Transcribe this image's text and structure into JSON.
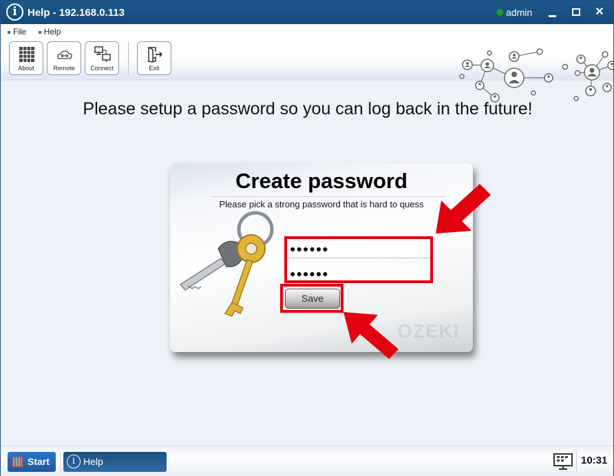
{
  "window": {
    "title": "Help - 192.168.0.113",
    "user": "admin",
    "status_color": "#1e9a2d",
    "controls": {
      "minimize": "minimize-icon",
      "maximize": "maximize-icon",
      "close": "close-icon"
    }
  },
  "menu": {
    "items": [
      "File",
      "Help"
    ]
  },
  "toolbar": {
    "buttons": [
      {
        "label": "About",
        "icon": "grid-icon"
      },
      {
        "label": "Remote",
        "icon": "cloud-arrows-icon"
      },
      {
        "label": "Connect",
        "icon": "network-computers-icon"
      },
      {
        "label": "Exit",
        "icon": "exit-door-icon"
      }
    ]
  },
  "main": {
    "headline": "Please setup a password so you can log back in the future!"
  },
  "dialog": {
    "title": "Create password",
    "subtitle": "Please pick a strong password that is hard to quess",
    "password_value": "●●●●●●",
    "confirm_value": "●●●●●●",
    "save_label": "Save",
    "watermark": "OZEKI",
    "highlight_color": "#e3000f"
  },
  "taskbar": {
    "start_label": "Start",
    "tasks": [
      {
        "label": "Help",
        "icon": "info-icon"
      }
    ],
    "clock": "10:31"
  }
}
